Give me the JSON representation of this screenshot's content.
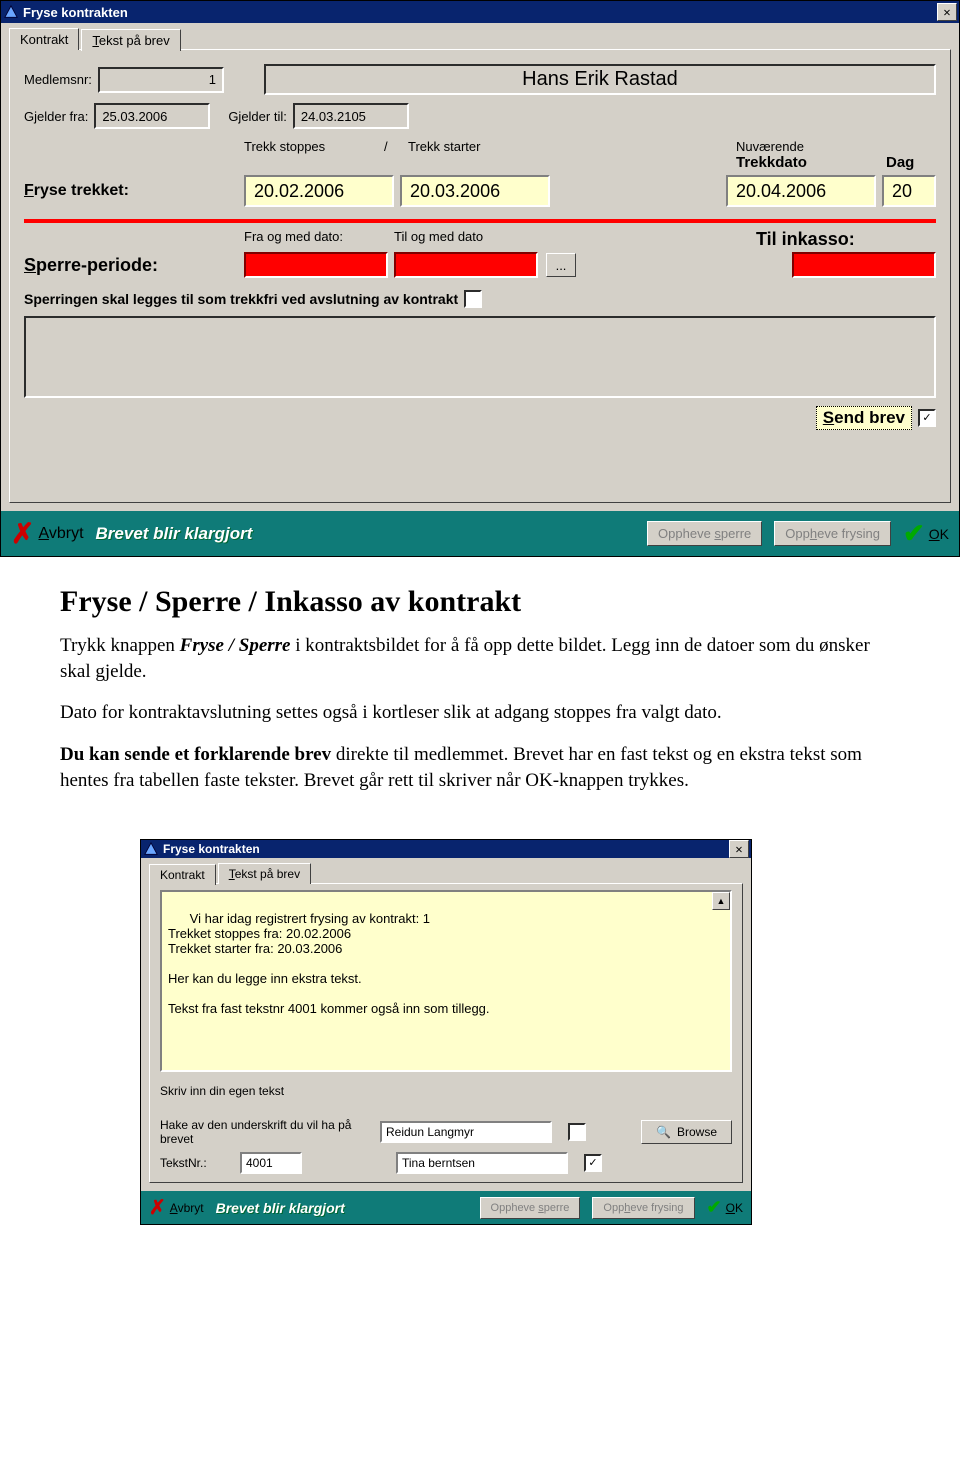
{
  "dialog1": {
    "title": "Fryse kontrakten",
    "tabs": {
      "kontrakt": "Kontrakt",
      "tekst": "Tekst på brev"
    },
    "labels": {
      "medlemsnr": "Medlemsnr:",
      "gjelder_fra": "Gjelder fra:",
      "gjelder_til": "Gjelder til:",
      "trekk_stoppes": "Trekk stoppes",
      "slash": "/",
      "trekk_starter": "Trekk starter",
      "nuvaerende": "Nuværende",
      "trekkdato": "Trekkdato",
      "dag": "Dag",
      "fryse_trekket": "Fryse trekket:",
      "sperre_periode": "Sperre-periode:",
      "fra_og_med": "Fra og med dato:",
      "til_og_med": "Til og med dato",
      "til_inkasso": "Til inkasso:",
      "sperringen": "Sperringen skal legges til som trekkfri ved avslutning av kontrakt",
      "send_brev": "Send brev"
    },
    "values": {
      "medlemsnr": "1",
      "name": "Hans Erik Rastad",
      "gjelder_fra": "25.03.2006",
      "gjelder_til": "24.03.2105",
      "trekk_stoppes": "20.02.2006",
      "trekk_starter": "20.03.2006",
      "trekkdato": "20.04.2006",
      "dag": "20"
    },
    "footer": {
      "avbryt": "Avbryt",
      "status": "Brevet blir klargjort",
      "oppheve_sperre": "Oppheve sperre",
      "oppheve_frysing": "Oppheve frysing",
      "ok": "OK"
    }
  },
  "article": {
    "h1": "Fryse / Sperre / Inkasso  av  kontrakt",
    "p1a": "Trykk knappen ",
    "p1b": "Fryse / Sperre",
    "p1c": " i kontraktsbildet for å få opp dette bildet. Legg inn de datoer som du ønsker skal gjelde.",
    "p2": "Dato for kontraktavslutning settes også i kortleser slik at adgang stoppes fra valgt dato.",
    "p3a": "Du kan sende et  forklarende brev",
    "p3b": " direkte til medlemmet. Brevet har en fast tekst og en ekstra tekst som hentes fra tabellen faste tekster. Brevet går rett til skriver når OK-knappen trykkes."
  },
  "dialog2": {
    "title": "Fryse kontrakten",
    "tabs": {
      "kontrakt": "Kontrakt",
      "tekst": "Tekst på brev"
    },
    "textarea": "Vi har idag registrert frysing av kontrakt: 1\nTrekket stoppes fra: 20.02.2006\nTrekket starter fra: 20.03.2006\n\nHer kan du legge inn ekstra tekst.\n\nTekst fra fast tekstnr 4001 kommer også inn som tillegg.",
    "labels": {
      "skriv_inn": "Skriv inn din egen tekst",
      "hake": "Hake av den  underskrift du vil ha på brevet",
      "tekstnr": "TekstNr.:",
      "browse": "Browse"
    },
    "values": {
      "sig1": "Reidun Langmyr",
      "sig2": "Tina berntsen",
      "tekstnr": "4001"
    },
    "footer": {
      "avbryt": "Avbryt",
      "status": "Brevet blir klargjort",
      "oppheve_sperre": "Oppheve sperre",
      "oppheve_frysing": "Oppheve frysing",
      "ok": "OK"
    }
  }
}
